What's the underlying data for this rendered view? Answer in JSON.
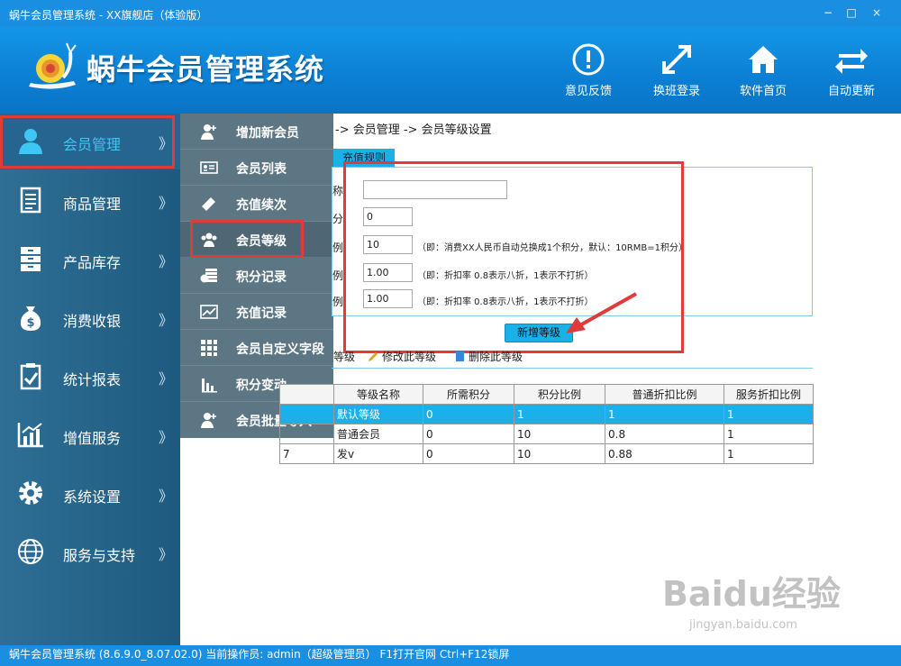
{
  "window": {
    "title": "蜗牛会员管理系统 - XX旗舰店（体验版）",
    "min": "−",
    "max": "□",
    "close": "×"
  },
  "header": {
    "app_name": "蜗牛会员管理系统",
    "tools": [
      {
        "label": "意见反馈",
        "icon": "feedback-icon"
      },
      {
        "label": "换班登录",
        "icon": "switch-shift-icon"
      },
      {
        "label": "软件首页",
        "icon": "home-icon"
      },
      {
        "label": "自动更新",
        "icon": "refresh-icon"
      }
    ]
  },
  "sidebar": {
    "chevron": "》",
    "items": [
      {
        "label": "会员管理",
        "icon": "member-icon",
        "active": true
      },
      {
        "label": "商品管理",
        "icon": "document-icon"
      },
      {
        "label": "产品库存",
        "icon": "cabinet-icon"
      },
      {
        "label": "消费收银",
        "icon": "money-bag-icon"
      },
      {
        "label": "统计报表",
        "icon": "clipboard-icon"
      },
      {
        "label": "增值服务",
        "icon": "chart-icon"
      },
      {
        "label": "系统设置",
        "icon": "gear-icon"
      },
      {
        "label": "服务与支持",
        "icon": "globe-icon"
      }
    ]
  },
  "submenu": {
    "items": [
      {
        "label": "增加新会员",
        "icon": "add-member-icon"
      },
      {
        "label": "会员列表",
        "icon": "id-card-icon"
      },
      {
        "label": "充值续次",
        "icon": "ticket-icon"
      },
      {
        "label": "会员等级",
        "icon": "group-icon"
      },
      {
        "label": "积分记录",
        "icon": "coins-icon"
      },
      {
        "label": "充值记录",
        "icon": "trend-icon"
      },
      {
        "label": "会员自定义字段",
        "icon": "grid-icon"
      },
      {
        "label": "积分变动",
        "icon": "bar-chart-icon"
      },
      {
        "label": "会员批量导入",
        "icon": "import-icon"
      }
    ]
  },
  "main": {
    "breadcrumb": "-> 会员管理 -> 会员等级设置",
    "tab": "充值规则",
    "form": {
      "fields": [
        {
          "label": "称:",
          "value": "",
          "hint": ""
        },
        {
          "label": "分:",
          "value": "0",
          "hint": ""
        },
        {
          "label": "例:",
          "value": "10",
          "hint": "（即：消费XX人民币自动兑换成1个积分，默认：10RMB=1积分）"
        },
        {
          "label": "例:",
          "value": "1.00",
          "hint": "（即：折扣率 0.8表示八折，1表示不打折）"
        },
        {
          "label": "例:",
          "value": "1.00",
          "hint": "（即：折扣率 0.8表示八折，1表示不打折）"
        }
      ],
      "submit": "新增等级"
    },
    "actions": {
      "add": "等级",
      "edit": "修改此等级",
      "delete": "删除此等级"
    },
    "table": {
      "columns": [
        "",
        "等级名称",
        "所需积分",
        "积分比例",
        "普通折扣比例",
        "服务折扣比例"
      ],
      "rows": [
        [
          "",
          "默认等级",
          "0",
          "1",
          "1",
          "1"
        ],
        [
          "",
          "普通会员",
          "0",
          "10",
          "0.8",
          "1"
        ],
        [
          "7",
          "发v",
          "0",
          "10",
          "0.88",
          "1"
        ]
      ],
      "selected_row": 0
    }
  },
  "statusbar": {
    "text": "蜗牛会员管理系统 (8.6.9.0_8.07.02.0)  当前操作员: admin（超级管理员）  F1打开官网 Ctrl+F12锁屏"
  },
  "watermark": {
    "big": "Baidu经验",
    "small": "jingyan.baidu.com"
  },
  "colors": {
    "header_blue": "#0b7fd4",
    "accent_cyan": "#1ab0e8",
    "sidebar_bg": "#2f6f95",
    "highlight_red": "#e13a3a"
  }
}
